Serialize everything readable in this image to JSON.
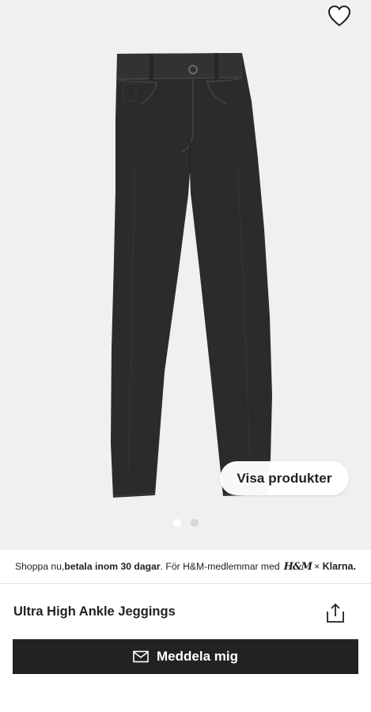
{
  "hero": {
    "visa_label": "Visa produkter",
    "dots": {
      "count": 2,
      "active_index": 0
    },
    "favorite_icon": "heart-outline-icon",
    "colors": {
      "background": "#f1efef",
      "jeans": "#2b2b2b"
    }
  },
  "banner": {
    "prefix": "Shoppa nu, ",
    "bold": "betala inom 30 dagar",
    "suffix": ". För H&M-medlemmar med",
    "hm_logo": "H&M",
    "times": "×",
    "klarna": "Klarna."
  },
  "product": {
    "title": "Ultra High Ankle Jeggings",
    "share_icon": "share-icon"
  },
  "cta": {
    "label": "Meddela mig",
    "icon": "envelope-icon",
    "color": "#222222"
  }
}
